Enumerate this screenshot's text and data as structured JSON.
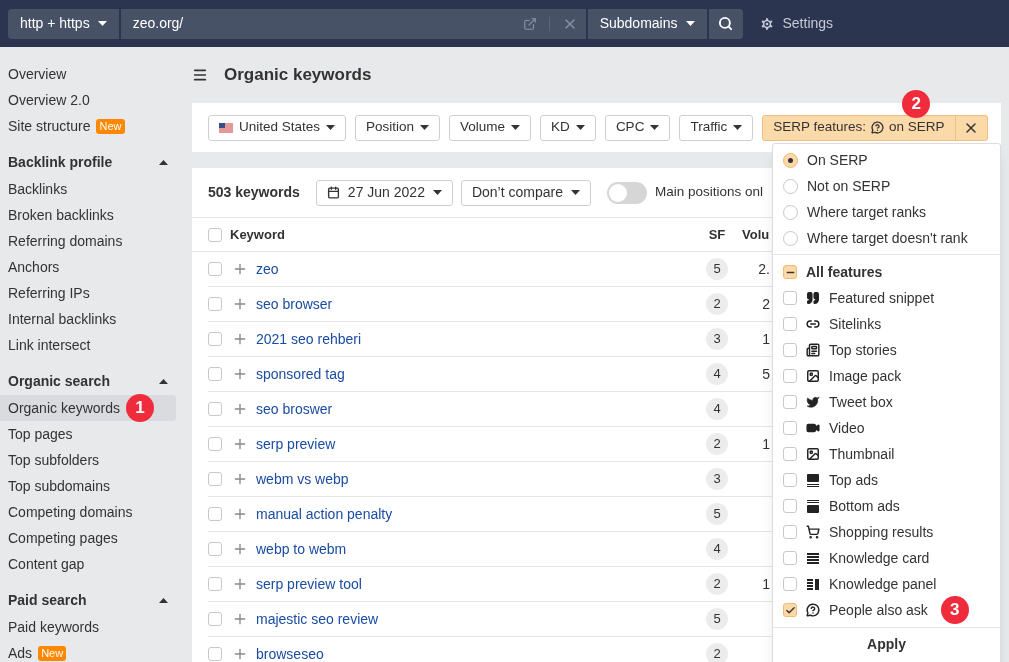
{
  "topbar": {
    "protocol": "http + https",
    "url": "zeo.org/",
    "scope": "Subdomains",
    "settings": "Settings"
  },
  "sidebar": {
    "sections": [
      {
        "items": [
          {
            "label": "Overview",
            "selected": false
          },
          {
            "label": "Overview 2.0",
            "selected": false
          },
          {
            "label": "Site structure",
            "selected": false,
            "badge": "New"
          }
        ]
      },
      {
        "heading": "Backlink profile",
        "expanded": true,
        "items": [
          {
            "label": "Backlinks",
            "selected": false
          },
          {
            "label": "Broken backlinks",
            "selected": false
          },
          {
            "label": "Referring domains",
            "selected": false
          },
          {
            "label": "Anchors",
            "selected": false
          },
          {
            "label": "Referring IPs",
            "selected": false
          },
          {
            "label": "Internal backlinks",
            "selected": false
          },
          {
            "label": "Link intersect",
            "selected": false
          }
        ]
      },
      {
        "heading": "Organic search",
        "expanded": true,
        "items": [
          {
            "label": "Organic keywords",
            "selected": true,
            "marker": "1"
          },
          {
            "label": "Top pages",
            "selected": false
          },
          {
            "label": "Top subfolders",
            "selected": false
          },
          {
            "label": "Top subdomains",
            "selected": false
          },
          {
            "label": "Competing domains",
            "selected": false
          },
          {
            "label": "Competing pages",
            "selected": false
          },
          {
            "label": "Content gap",
            "selected": false
          }
        ]
      },
      {
        "heading": "Paid search",
        "expanded": true,
        "items": [
          {
            "label": "Paid keywords",
            "selected": false
          },
          {
            "label": "Ads",
            "selected": false,
            "badge": "New"
          }
        ]
      }
    ]
  },
  "page": {
    "title": "Organic keywords"
  },
  "filters": [
    {
      "label": "United States",
      "kind": "country"
    },
    {
      "label": "Position",
      "kind": "plain"
    },
    {
      "label": "Volume",
      "kind": "plain"
    },
    {
      "label": "KD",
      "kind": "plain"
    },
    {
      "label": "CPC",
      "kind": "plain"
    },
    {
      "label": "Traffic",
      "kind": "plain"
    }
  ],
  "serp_filter": {
    "prefix": "SERP features:",
    "suffix": "on SERP",
    "active": true,
    "marker": "2"
  },
  "toolbar": {
    "count": "503 keywords",
    "date": "27 Jun 2022",
    "compare": "Don’t compare",
    "toggle": {
      "label": "Main positions onl",
      "on": false
    }
  },
  "table": {
    "all_checked": false,
    "columns": [
      "Keyword",
      "SF",
      "Volu"
    ],
    "rows": [
      {
        "keyword": "zeo",
        "sf": "5",
        "volume": "2.",
        "checked": false
      },
      {
        "keyword": "seo browser",
        "sf": "2",
        "volume": "2",
        "checked": false
      },
      {
        "keyword": "2021 seo rehberi",
        "sf": "3",
        "volume": "1",
        "checked": false
      },
      {
        "keyword": "sponsored tag",
        "sf": "4",
        "volume": "5",
        "checked": false
      },
      {
        "keyword": "seo broswer",
        "sf": "4",
        "checked": false
      },
      {
        "keyword": "serp preview",
        "sf": "2",
        "volume": "1",
        "checked": false
      },
      {
        "keyword": "webm vs webp",
        "sf": "3",
        "checked": false
      },
      {
        "keyword": "manual action penalty",
        "sf": "5",
        "checked": false
      },
      {
        "keyword": "webp to webm",
        "sf": "4",
        "checked": false
      },
      {
        "keyword": "serp preview tool",
        "sf": "2",
        "volume": "1",
        "checked": false
      },
      {
        "keyword": "majestic seo review",
        "sf": "5",
        "checked": false
      },
      {
        "keyword": "browseseo",
        "sf": "2",
        "checked": false
      }
    ]
  },
  "dropdown": {
    "options": [
      {
        "label": "On SERP",
        "selected": true
      },
      {
        "label": "Not on SERP",
        "selected": false
      },
      {
        "label": "Where target ranks",
        "selected": false
      },
      {
        "label": "Where target doesn't rank",
        "selected": false
      }
    ],
    "all": {
      "label": "All features",
      "indeterminate": true
    },
    "features": [
      {
        "label": "Featured snippet",
        "checked": false
      },
      {
        "label": "Sitelinks",
        "checked": false
      },
      {
        "label": "Top stories",
        "checked": false
      },
      {
        "label": "Image pack",
        "checked": false
      },
      {
        "label": "Tweet box",
        "checked": false
      },
      {
        "label": "Video",
        "checked": false
      },
      {
        "label": "Thumbnail",
        "checked": false
      },
      {
        "label": "Top ads",
        "checked": false
      },
      {
        "label": "Bottom ads",
        "checked": false
      },
      {
        "label": "Shopping results",
        "checked": false
      },
      {
        "label": "Knowledge card",
        "checked": false
      },
      {
        "label": "Knowledge panel",
        "checked": false
      },
      {
        "label": "People also ask",
        "checked": true,
        "marker": "3"
      }
    ],
    "apply": "Apply"
  }
}
